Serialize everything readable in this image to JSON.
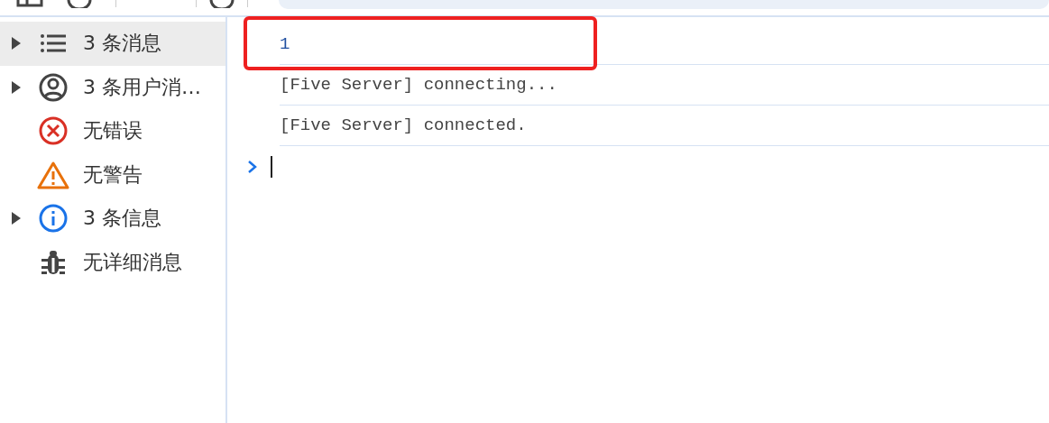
{
  "sidebar": {
    "items": [
      {
        "kind": "list",
        "label": "3 条消息",
        "expandable": true,
        "selected": true
      },
      {
        "kind": "user",
        "label": "3 条用户消…",
        "expandable": true,
        "selected": false
      },
      {
        "kind": "error",
        "label": "无错误",
        "expandable": false,
        "selected": false
      },
      {
        "kind": "warning",
        "label": "无警告",
        "expandable": false,
        "selected": false
      },
      {
        "kind": "info",
        "label": "3 条信息",
        "expandable": true,
        "selected": false
      },
      {
        "kind": "verbose",
        "label": "无详细消息",
        "expandable": false,
        "selected": false
      }
    ]
  },
  "console": {
    "messages": [
      {
        "text": "1",
        "kind": "value",
        "highlighted": true
      },
      {
        "text": "[Five Server] connecting...",
        "kind": "log",
        "highlighted": false
      },
      {
        "text": "[Five Server] connected.",
        "kind": "log",
        "highlighted": false
      }
    ]
  }
}
